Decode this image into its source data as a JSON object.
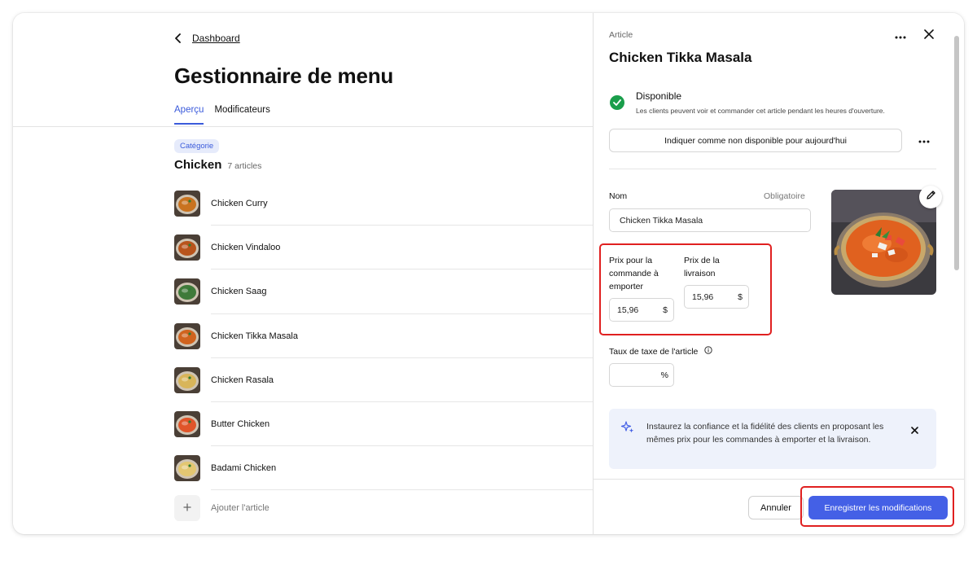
{
  "left": {
    "back_link": "Dashboard",
    "title": "Gestionnaire de menu",
    "tabs": [
      {
        "label": "Aperçu",
        "active": true
      },
      {
        "label": "Modificateurs",
        "active": false
      }
    ],
    "category_badge": "Catégorie",
    "category_name": "Chicken",
    "category_count": "7 articles",
    "items": [
      {
        "name": "Chicken Curry",
        "thumb_color": "#c9731f"
      },
      {
        "name": "Chicken Vindaloo",
        "thumb_color": "#b8541c"
      },
      {
        "name": "Chicken Saag",
        "thumb_color": "#3f7a3a"
      },
      {
        "name": "Chicken Tikka Masala",
        "thumb_color": "#d0631e"
      },
      {
        "name": "Chicken Rasala",
        "thumb_color": "#d8b55a"
      },
      {
        "name": "Butter Chicken",
        "thumb_color": "#e0552a"
      },
      {
        "name": "Badami Chicken",
        "thumb_color": "#e3c772"
      }
    ],
    "add_item_label": "Ajouter l'article"
  },
  "panel": {
    "eyebrow": "Article",
    "title": "Chicken Tikka Masala",
    "status_title": "Disponible",
    "status_description": "Les clients peuvent voir et commander cet article pendant les heures d'ouverture.",
    "unavailable_button": "Indiquer comme non disponible pour aujourd'hui",
    "name_label": "Nom",
    "required_label": "Obligatoire",
    "name_value": "Chicken Tikka Masala",
    "takeout_price_label": "Prix pour la commande à emporter",
    "takeout_price_value": "15,96",
    "delivery_price_label": "Prix de la livraison",
    "delivery_price_value": "15,96",
    "currency": "$",
    "tax_label": "Taux de taxe de l'article",
    "tax_value": "",
    "tax_unit": "%",
    "info_text": "Instaurez la confiance et la fidélité des clients en proposant les mêmes prix pour les commandes à emporter et la livraison.",
    "cancel_button": "Annuler",
    "save_button": "Enregistrer les modifications"
  },
  "colors": {
    "accent": "#3b5bdb",
    "primary_button": "#4460e6",
    "success": "#1a9e4b",
    "highlight": "#e02020"
  },
  "icons": [
    "chevron-left-icon",
    "more-horizontal-icon",
    "close-icon",
    "check-icon",
    "pencil-icon",
    "info-icon",
    "sparkle-icon",
    "plus-icon"
  ]
}
